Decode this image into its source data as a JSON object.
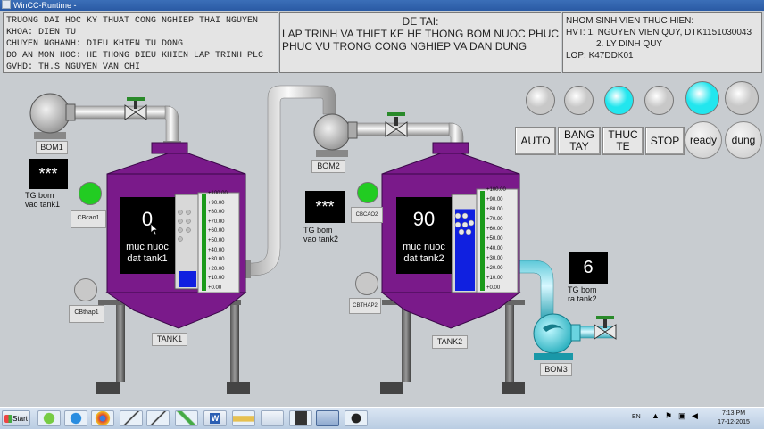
{
  "window": {
    "title": "WinCC-Runtime -"
  },
  "header": {
    "left": [
      "TRUONG DAI HOC KY THUAT CONG NGHIEP THAI NGUYEN",
      "KHOA: DIEN TU",
      "CHUYEN NGHANH: DIEU KHIEN TU DONG",
      "DO AN MON HOC: HE THONG DIEU KHIEN LAP TRINH PLC",
      "GVHD: TH.S NGUYEN VAN CHI"
    ],
    "center": [
      "DE TAI:",
      "LAP TRINH VA THIET KE HE THONG BOM NUOC PHUC",
      "PHUC VU TRONG CONG NGHIEP VA DAN DUNG"
    ],
    "right": [
      "NHOM SINH VIEN THUC HIEN:",
      "HVT: 1. NGUYEN VIEN QUY, DTK1151030043",
      "2. LY DINH QUY",
      "LOP: K47DDK01"
    ]
  },
  "pumps": {
    "bom1": "BOM1",
    "bom2": "BOM2",
    "bom3": "BOM3"
  },
  "timers": {
    "t1": {
      "value": "***",
      "label1": "TG bom",
      "label2": "vao tank1"
    },
    "t2": {
      "value": "***",
      "label1": "TG bom",
      "label2": "vao tank2"
    },
    "t3": {
      "value": "6",
      "label1": "TG bom",
      "label2": "ra tank2"
    }
  },
  "sensors": {
    "cbcao1": "CBcao1",
    "cbthap1": "CBthap1",
    "cbcao2": "CBCAO2",
    "cbthap2": "CBTHAP2"
  },
  "tank1": {
    "name": "TANK1",
    "level_value": "0",
    "level_label1": "muc nuoc",
    "level_label2": "dat tank1",
    "fill_fraction": 0.18
  },
  "tank2": {
    "name": "TANK2",
    "level_value": "90",
    "level_label1": "muc nuoc",
    "level_label2": "dat tank2",
    "fill_fraction": 0.88
  },
  "scale": [
    "+100.00",
    "+90.00",
    "+80.00",
    "+70.00",
    "+60.00",
    "+50.00",
    "+40.00",
    "+30.00",
    "+20.00",
    "+10.00",
    "+0.00"
  ],
  "controls": {
    "auto": "AUTO",
    "manual1": "BANG",
    "manual2": "TAY",
    "real1": "THUC",
    "real2": "TE",
    "stop": "STOP",
    "ready": "ready",
    "dung": "dung"
  },
  "lamps": [
    "#c8c8c8",
    "#c8c8c8",
    "#22e6ee",
    "#c8c8c8",
    "#22e6ee",
    "#c8c8c8"
  ],
  "colors": {
    "tank": "#7a1a8a",
    "water": "#1020e0",
    "lamp_on": "#22e6ee",
    "sensor_on": "#22cc22"
  },
  "taskbar": {
    "start": "Start",
    "lang": "EN",
    "time": "7:13 PM",
    "date": "17-12-2015"
  }
}
